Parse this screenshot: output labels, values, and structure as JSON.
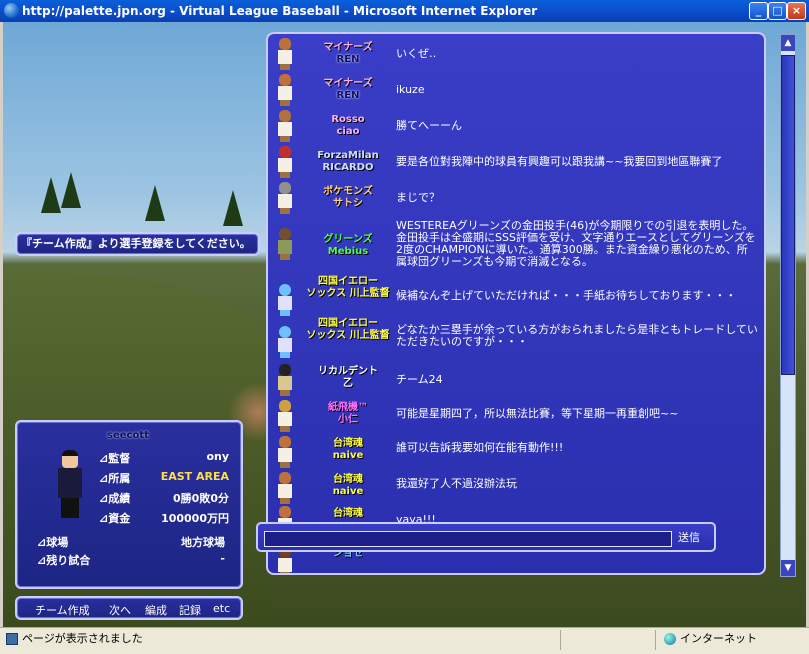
{
  "window": {
    "title": "http://palette.jpn.org - Virtual League Baseball - Microsoft Internet Explorer",
    "minimize": "_",
    "maximize": "□",
    "close": "×"
  },
  "notice": "『チーム作成』より選手登録をしてください。",
  "player": {
    "name": "seecott",
    "rows": [
      {
        "label": "⊿監督",
        "value": "ony"
      },
      {
        "label": "⊿所属",
        "value": "EAST AREA"
      },
      {
        "label": "⊿成績",
        "value": "0勝0敗0分"
      },
      {
        "label": "⊿資金",
        "value": "100000万円"
      }
    ],
    "lower": [
      {
        "label": "⊿球場",
        "value": "地方球場"
      },
      {
        "label": "⊿残り試合",
        "value": "-"
      }
    ]
  },
  "menu": [
    "チーム作成",
    "次へ",
    "編成",
    "記録",
    "etc"
  ],
  "chat": [
    {
      "team": "マイナーズ",
      "team2": "REN",
      "text": "いくぜ‥",
      "color": "c-pink"
    },
    {
      "team": "マイナーズ",
      "team2": "REN",
      "text": "ikuze",
      "color": "c-pink"
    },
    {
      "team": "Rosso",
      "team2": "ciao",
      "text": "勝てへーーん",
      "color": "c-purple"
    },
    {
      "team": "ForzaMilan",
      "team2": "RICARDO",
      "text": "要是各位對我陣中的球員有興趣可以跟我講~~我要回到地區聯賽了",
      "color": "c-navy"
    },
    {
      "team": "ポケモンズ",
      "team2": "サトシ",
      "text": "まじで？",
      "color": "c-orange"
    },
    {
      "team": "グリーンズ",
      "team2": "Mebius",
      "text": "WESTEREAグリーンズの金田投手(46)が今期限りでの引退を表明した。金田投手は全盛期にSSS評価を受け、文字通りエースとしてグリーンズを2度のCHAMPIONに導いた。通算300勝。また資金繰り悪化のため、所属球団グリーンズも今期で消滅となる。",
      "color": "c-green"
    },
    {
      "team": "四国イエロー",
      "team2": "ソックス 川上監督",
      "text": "候補なんぞ上げていただければ・・・手紙お待ちしております・・・",
      "color": "c-yellow"
    },
    {
      "team": "四国イエロー",
      "team2": "ソックス 川上監督",
      "text": "どなたか三塁手が余っている方がおられましたら是非ともトレードしていただきたいのですが・・・",
      "color": "c-yellow"
    },
    {
      "team": "リカルデント",
      "team2": "乙",
      "text": "チーム24",
      "color": "c-white"
    },
    {
      "team": "紙飛機™",
      "team2": "小仁",
      "text": "可能是星期四了，所以無法比賽，等下星期一再重創吧~~",
      "color": "c-magenta"
    },
    {
      "team": "台湾魂",
      "team2": "naive",
      "text": "誰可以告訴我要如何在能有動作!!!",
      "color": "c-yellow"
    },
    {
      "team": "台湾魂",
      "team2": "naive",
      "text": "我還好了人不過沒辦法玩",
      "color": "c-yellow"
    },
    {
      "team": "台湾魂",
      "team2": "",
      "text": "yaya!!!",
      "color": "c-yellow"
    },
    {
      "team": "",
      "team2": "ショセ",
      "text": "",
      "color": "c-white"
    }
  ],
  "send_label": "送信",
  "statusbar": {
    "text": "ページが表示されました",
    "zone": "インターネット"
  }
}
